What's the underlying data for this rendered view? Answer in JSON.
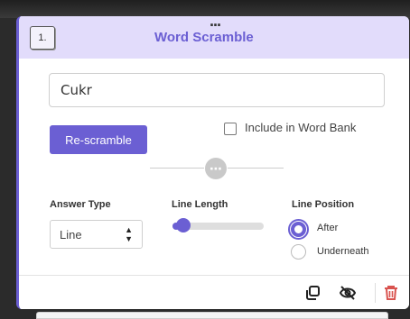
{
  "card": {
    "drag_handle": "...",
    "number": "1.",
    "title": "Word Scramble",
    "word_value": "Cukr",
    "rescramble_label": "Re-scramble",
    "include_word_bank": {
      "label": "Include in Word Bank",
      "checked": false
    },
    "answer_type": {
      "label": "Answer Type",
      "value": "Line"
    },
    "line_length": {
      "label": "Line Length",
      "fraction": 0.05
    },
    "line_position": {
      "label": "Line Position",
      "options": [
        {
          "label": "After",
          "selected": true
        },
        {
          "label": "Underneath",
          "selected": false
        }
      ]
    },
    "footer_icons": [
      "copy-icon",
      "eye-off-icon",
      "trash-icon"
    ]
  },
  "colors": {
    "accent": "#6b5fd3",
    "header_bg": "#e2dcfb",
    "delete": "#d9534f"
  }
}
